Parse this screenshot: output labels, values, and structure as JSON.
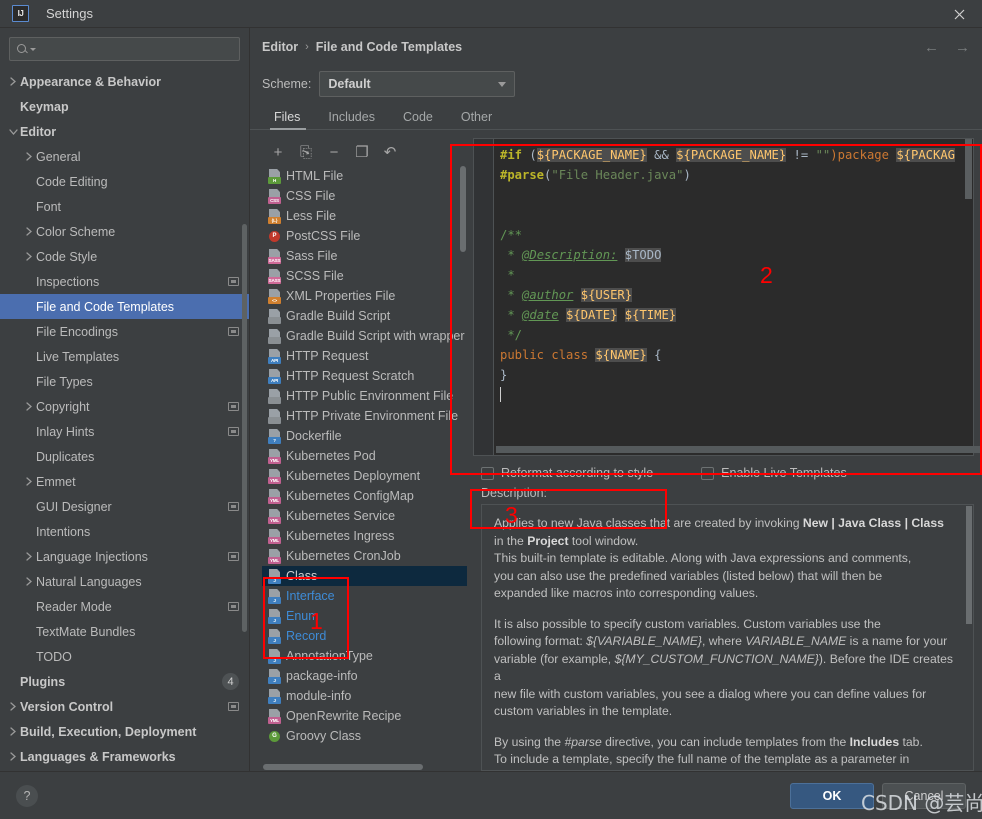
{
  "window": {
    "title": "Settings",
    "logo_text": "IJ",
    "close_icon": "close-icon"
  },
  "sidebar": {
    "search": {
      "value": "",
      "placeholder": ""
    },
    "items": [
      {
        "label": "Appearance & Behavior",
        "level": 0,
        "arrow": "right",
        "bold": true
      },
      {
        "label": "Keymap",
        "level": 0,
        "arrow": "none",
        "bold": true
      },
      {
        "label": "Editor",
        "level": 0,
        "arrow": "down",
        "bold": true
      },
      {
        "label": "General",
        "level": 1,
        "arrow": "right",
        "bold": false
      },
      {
        "label": "Code Editing",
        "level": 1,
        "arrow": "none",
        "bold": false
      },
      {
        "label": "Font",
        "level": 1,
        "arrow": "none",
        "bold": false
      },
      {
        "label": "Color Scheme",
        "level": 1,
        "arrow": "right",
        "bold": false
      },
      {
        "label": "Code Style",
        "level": 1,
        "arrow": "right",
        "bold": false
      },
      {
        "label": "Inspections",
        "level": 1,
        "arrow": "none",
        "bold": false,
        "badge": "window-icon"
      },
      {
        "label": "File and Code Templates",
        "level": 1,
        "arrow": "none",
        "bold": false,
        "selected": true
      },
      {
        "label": "File Encodings",
        "level": 1,
        "arrow": "none",
        "bold": false,
        "badge": "window-icon"
      },
      {
        "label": "Live Templates",
        "level": 1,
        "arrow": "none",
        "bold": false
      },
      {
        "label": "File Types",
        "level": 1,
        "arrow": "none",
        "bold": false
      },
      {
        "label": "Copyright",
        "level": 1,
        "arrow": "right",
        "bold": false,
        "badge": "window-icon"
      },
      {
        "label": "Inlay Hints",
        "level": 1,
        "arrow": "none",
        "bold": false,
        "badge": "window-icon"
      },
      {
        "label": "Duplicates",
        "level": 1,
        "arrow": "none",
        "bold": false
      },
      {
        "label": "Emmet",
        "level": 1,
        "arrow": "right",
        "bold": false
      },
      {
        "label": "GUI Designer",
        "level": 1,
        "arrow": "none",
        "bold": false,
        "badge": "window-icon"
      },
      {
        "label": "Intentions",
        "level": 1,
        "arrow": "none",
        "bold": false
      },
      {
        "label": "Language Injections",
        "level": 1,
        "arrow": "right",
        "bold": false,
        "badge": "window-icon"
      },
      {
        "label": "Natural Languages",
        "level": 1,
        "arrow": "right",
        "bold": false
      },
      {
        "label": "Reader Mode",
        "level": 1,
        "arrow": "none",
        "bold": false,
        "badge": "window-icon"
      },
      {
        "label": "TextMate Bundles",
        "level": 1,
        "arrow": "none",
        "bold": false
      },
      {
        "label": "TODO",
        "level": 1,
        "arrow": "none",
        "bold": false
      },
      {
        "label": "Plugins",
        "level": 0,
        "arrow": "none",
        "bold": true,
        "count": "4"
      },
      {
        "label": "Version Control",
        "level": 0,
        "arrow": "right",
        "bold": true,
        "badge": "window-icon"
      },
      {
        "label": "Build, Execution, Deployment",
        "level": 0,
        "arrow": "right",
        "bold": true
      },
      {
        "label": "Languages & Frameworks",
        "level": 0,
        "arrow": "right",
        "bold": true
      }
    ]
  },
  "breadcrumb": {
    "parent": "Editor",
    "separator": "›",
    "current": "File and Code Templates",
    "back_icon": "arrow-left-icon",
    "forward_icon": "arrow-right-icon"
  },
  "scheme": {
    "label": "Scheme:",
    "value": "Default",
    "dropdown_icon": "chevron-down-icon"
  },
  "tabs": [
    {
      "label": "Files",
      "active": true
    },
    {
      "label": "Includes",
      "active": false
    },
    {
      "label": "Code",
      "active": false
    },
    {
      "label": "Other",
      "active": false
    }
  ],
  "list_toolbar": [
    {
      "name": "add-template-button",
      "glyph": "+"
    },
    {
      "name": "copy-template-button",
      "glyph": "⎘"
    },
    {
      "name": "remove-template-button",
      "glyph": "−"
    },
    {
      "name": "duplicate-template-button",
      "glyph": "❐"
    },
    {
      "name": "reset-template-button",
      "glyph": "↶"
    }
  ],
  "templates": [
    {
      "label": "HTML File",
      "tag": "H",
      "tagColor": "#5c9a3a"
    },
    {
      "label": "CSS File",
      "tag": "CSS",
      "tagColor": "#c06090"
    },
    {
      "label": "Less File",
      "tag": "{L}",
      "tagColor": "#d0802f"
    },
    {
      "label": "PostCSS File",
      "tag": "P",
      "tagColor": "#c0392b",
      "round": true
    },
    {
      "label": "Sass File",
      "tag": "SASS",
      "tagColor": "#cf6a98"
    },
    {
      "label": "SCSS File",
      "tag": "SASS",
      "tagColor": "#cf6a98"
    },
    {
      "label": "XML Properties File",
      "tag": "<>",
      "tagColor": "#d0802f"
    },
    {
      "label": "Gradle Build Script",
      "tag": "",
      "tagColor": "#8a8f93",
      "elephant": true
    },
    {
      "label": "Gradle Build Script with wrapper",
      "tag": "",
      "tagColor": "#8a8f93",
      "elephant": true
    },
    {
      "label": "HTTP Request",
      "tag": "API",
      "tagColor": "#3f7fbf"
    },
    {
      "label": "HTTP Request Scratch",
      "tag": "API",
      "tagColor": "#3f7fbf"
    },
    {
      "label": "HTTP Public Environment File",
      "tag": "",
      "tagColor": "#8a8f93",
      "globe": true
    },
    {
      "label": "HTTP Private Environment File",
      "tag": "",
      "tagColor": "#8a8f93",
      "globe": true
    },
    {
      "label": "Dockerfile",
      "tag": "?",
      "tagColor": "#3f7fbf",
      "docker": true
    },
    {
      "label": "Kubernetes Pod",
      "tag": "YML",
      "tagColor": "#c06090"
    },
    {
      "label": "Kubernetes Deployment",
      "tag": "YML",
      "tagColor": "#c06090"
    },
    {
      "label": "Kubernetes ConfigMap",
      "tag": "YML",
      "tagColor": "#c06090"
    },
    {
      "label": "Kubernetes Service",
      "tag": "YML",
      "tagColor": "#c06090"
    },
    {
      "label": "Kubernetes Ingress",
      "tag": "YML",
      "tagColor": "#c06090"
    },
    {
      "label": "Kubernetes CronJob",
      "tag": "YML",
      "tagColor": "#c06090"
    },
    {
      "label": "Class",
      "tag": "J",
      "tagColor": "#3f7fbf",
      "selected": true
    },
    {
      "label": "Interface",
      "tag": "J",
      "tagColor": "#3f7fbf",
      "java": true
    },
    {
      "label": "Enum",
      "tag": "J",
      "tagColor": "#3f7fbf",
      "java": true
    },
    {
      "label": "Record",
      "tag": "J",
      "tagColor": "#3f7fbf",
      "java": true
    },
    {
      "label": "AnnotationType",
      "tag": "J",
      "tagColor": "#3f7fbf"
    },
    {
      "label": "package-info",
      "tag": "J",
      "tagColor": "#3f7fbf"
    },
    {
      "label": "module-info",
      "tag": "J",
      "tagColor": "#3f7fbf"
    },
    {
      "label": "OpenRewrite Recipe",
      "tag": "YML",
      "tagColor": "#c06090"
    },
    {
      "label": "Groovy Class",
      "tag": "G",
      "tagColor": "#5c9a3a",
      "round": true
    }
  ],
  "editor": {
    "lines": [
      "#if (${PACKAGE_NAME} && ${PACKAGE_NAME} != \"\")package ${PACKAG",
      "#parse(\"File Header.java\")",
      "",
      "",
      "/**",
      " * @Description: $TODO",
      " *",
      " * @author ${USER}",
      " * @date ${DATE} ${TIME}",
      " */",
      "public class ${NAME} {",
      "}",
      ""
    ]
  },
  "options": {
    "reformat": {
      "label": "Reformat according to style",
      "checked": false
    },
    "live_templates": {
      "label": "Enable Live Templates",
      "checked": false
    }
  },
  "description": {
    "label": "Description:",
    "paragraphs": [
      "Applies to new Java classes that are created by invoking New | Java Class | Class in the Project tool window.\nThis built-in template is editable. Along with Java expressions and comments, you can also use the predefined variables (listed below) that will then be expanded like macros into corresponding values.",
      "It is also possible to specify custom variables. Custom variables use the following format: ${VARIABLE_NAME}, where VARIABLE_NAME is a name for your variable (for example, ${MY_CUSTOM_FUNCTION_NAME}). Before the IDE creates a new file with custom variables, you see a dialog where you can define values for custom variables in the template.",
      "By using the #parse directive, you can include templates from the Includes tab. To include a template, specify the full name of the template as a parameter in quotation marks (for example, #parse(\"File Header.java\")."
    ]
  },
  "footer": {
    "help_icon": "question-mark-icon",
    "ok_label": "OK",
    "cancel_label": "Cancel"
  },
  "annotations": [
    {
      "number": "1",
      "target": "java-template-group"
    },
    {
      "number": "2",
      "target": "template-editor"
    },
    {
      "number": "3",
      "target": "reformat-checkbox"
    }
  ],
  "watermark": {
    "text": "CSDN @芸尚非"
  }
}
